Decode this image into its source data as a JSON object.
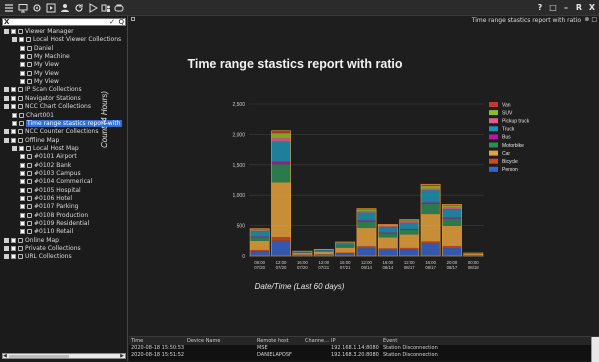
{
  "toolbar": {
    "icons": [
      "menu-icon",
      "monitor-icon",
      "settings-icon",
      "media-icon",
      "user-icon",
      "refresh-icon",
      "play-icon",
      "devices-icon",
      "link-icon"
    ],
    "window_controls": [
      "?",
      "□",
      "–",
      "R",
      "X"
    ]
  },
  "search": {
    "clear": "X",
    "check": "✓",
    "search": "Q"
  },
  "tree": [
    {
      "label": "Viewer Manager",
      "indent": 0,
      "exp": true
    },
    {
      "label": "Local Host Viewer Collections",
      "indent": 1,
      "exp": true
    },
    {
      "label": "Daniel",
      "indent": 2
    },
    {
      "label": "My Machine",
      "indent": 2
    },
    {
      "label": "My View",
      "indent": 2
    },
    {
      "label": "My View",
      "indent": 2
    },
    {
      "label": "My View",
      "indent": 2
    },
    {
      "label": "IP Scan Collections",
      "indent": 0,
      "exp": true
    },
    {
      "label": "Navigator Stations",
      "indent": 0,
      "exp": true
    },
    {
      "label": "NCC Chart Collections",
      "indent": 0,
      "exp": true
    },
    {
      "label": "Chart001",
      "indent": 1
    },
    {
      "label": "Time range stastics report with",
      "indent": 1,
      "selected": true
    },
    {
      "label": "NCC Counter Collections",
      "indent": 0,
      "exp": true
    },
    {
      "label": "Offline Map",
      "indent": 0,
      "exp": true
    },
    {
      "label": "Local Host Map",
      "indent": 1,
      "exp": true
    },
    {
      "label": "#0101 Airport",
      "indent": 2
    },
    {
      "label": "#0102 Bank",
      "indent": 2
    },
    {
      "label": "#0103 Campus",
      "indent": 2
    },
    {
      "label": "#0104 Commerical",
      "indent": 2
    },
    {
      "label": "#0105 Hospital",
      "indent": 2
    },
    {
      "label": "#0106 Hotel",
      "indent": 2
    },
    {
      "label": "#0107 Parking",
      "indent": 2
    },
    {
      "label": "#0108 Production",
      "indent": 2
    },
    {
      "label": "#0109 Residential",
      "indent": 2
    },
    {
      "label": "#0110 Retail",
      "indent": 2
    },
    {
      "label": "Online Map",
      "indent": 0,
      "exp": true
    },
    {
      "label": "Private Collections",
      "indent": 0,
      "exp": true
    },
    {
      "label": "URL Collections",
      "indent": 0,
      "exp": true
    }
  ],
  "tab": {
    "title": "Time range stastics report with ratio",
    "buttons": "⊗ □"
  },
  "chart_data": {
    "type": "bar",
    "title": "Time range stastics report with ratio",
    "xlabel": "Date/Time (Last 60 days)",
    "ylabel": "Count (4 Hours)",
    "ylim": [
      0,
      2500
    ],
    "yticks": [
      "0",
      "500",
      "1,000",
      "1,500",
      "2,000",
      "2,500"
    ],
    "categories": [
      "08:00\n07/20",
      "12:00\n07/20",
      "16:00\n07/20",
      "12:00\n07/21",
      "16:00\n07/21",
      "12:00\n08/14",
      "16:00\n08/14",
      "12:00\n08/17",
      "16:00\n08/17",
      "20:00\n08/17",
      "00:00\n08/18"
    ],
    "totals": [
      450,
      2060,
      80,
      110,
      230,
      780,
      520,
      600,
      1180,
      850,
      50
    ],
    "series": [
      {
        "name": "Van",
        "color": "#c0392b",
        "values": [
          10,
          40,
          2,
          2,
          5,
          15,
          10,
          12,
          25,
          20,
          1
        ]
      },
      {
        "name": "SUV",
        "color": "#8cbf26",
        "values": [
          20,
          80,
          3,
          4,
          8,
          30,
          20,
          25,
          45,
          35,
          2
        ]
      },
      {
        "name": "Pickup truck",
        "color": "#e05f8a",
        "values": [
          10,
          60,
          2,
          3,
          6,
          20,
          15,
          18,
          30,
          25,
          1
        ]
      },
      {
        "name": "Truck",
        "color": "#1e90b0",
        "values": [
          90,
          330,
          10,
          15,
          40,
          130,
          90,
          100,
          200,
          140,
          5
        ]
      },
      {
        "name": "Bus",
        "color": "#b5179e",
        "values": [
          10,
          40,
          2,
          2,
          5,
          15,
          10,
          12,
          20,
          15,
          1
        ]
      },
      {
        "name": "Motorbike",
        "color": "#2e8b57",
        "values": [
          60,
          300,
          8,
          12,
          30,
          110,
          70,
          80,
          170,
          120,
          4
        ]
      },
      {
        "name": "Car",
        "color": "#e6a23c",
        "values": [
          150,
          900,
          30,
          45,
          80,
          300,
          180,
          220,
          450,
          330,
          20
        ]
      },
      {
        "name": "Bicycle",
        "color": "#cc4a1f",
        "values": [
          20,
          60,
          5,
          5,
          10,
          30,
          25,
          25,
          40,
          35,
          3
        ]
      },
      {
        "name": "Person",
        "color": "#3a63c9",
        "values": [
          80,
          250,
          18,
          22,
          46,
          130,
          100,
          108,
          200,
          130,
          13
        ]
      }
    ]
  },
  "log": {
    "headers": [
      "Time",
      "Device Name",
      "Remote host",
      "Channe...",
      "IP",
      "Event"
    ],
    "rows": [
      [
        "2020-08-18 15:50:53",
        "",
        "MSE",
        "",
        "192.168.1.14:8080",
        "Station Disconnection"
      ],
      [
        "2020-08-18 15:51:52",
        "",
        "DANIELAPOSF",
        "",
        "192.168.3.20:8080",
        "Station Disconnection"
      ]
    ]
  }
}
